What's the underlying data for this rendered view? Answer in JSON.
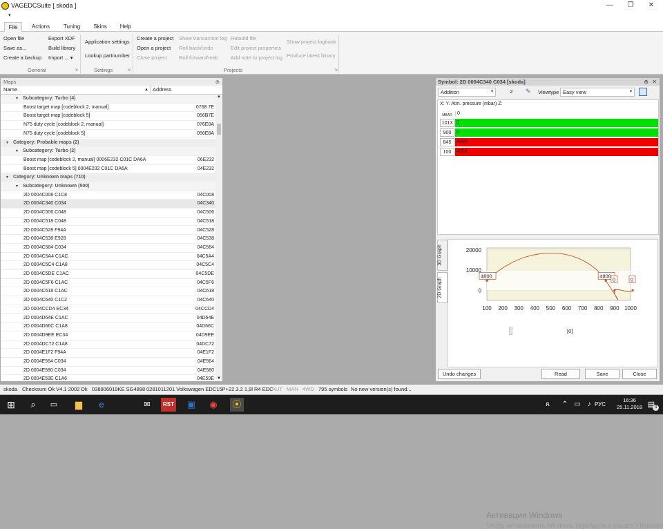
{
  "window": {
    "title": "VAGEDCSuite [ skoda ]"
  },
  "ribbon": {
    "tabs": [
      "File",
      "Actions",
      "Tuning",
      "Skins",
      "Help"
    ],
    "general": {
      "items": [
        "Open file",
        "Save as...",
        "Create a backup",
        "Export XDF",
        "Build library",
        "Import ..."
      ],
      "label": "General"
    },
    "settings": {
      "items": [
        "Application settings",
        "Lookup partnumber"
      ],
      "label": "Settings"
    },
    "projects": {
      "items": [
        "Create a project",
        "Open a project",
        "Close project",
        "Show transaction log",
        "Roll back/undo",
        "Roll forward/redo",
        "Rebuild file",
        "Edit project properties",
        "Add note to project log",
        "Show project logbook",
        "Produce latest binary"
      ],
      "label": "Projects"
    }
  },
  "maps": {
    "panel_title": "Maps",
    "pin": "⊕",
    "col_name": "Name",
    "col_address": "Address",
    "rows": [
      {
        "t": "sub",
        "n": "Subcategory: Turbo (4)"
      },
      {
        "t": "item",
        "n": "Boost target map [codeblock 2, manual]",
        "a": "0768 7E"
      },
      {
        "t": "item",
        "n": "Boost target map [codeblock 5]",
        "a": "056B7E"
      },
      {
        "t": "item",
        "n": "N75 duty cycle [codeblock 2, manual]",
        "a": "076E8A"
      },
      {
        "t": "item",
        "n": "N75 duty cycle [codeblock 5]",
        "a": "056E8A"
      },
      {
        "t": "cat",
        "n": "Category: Probable maps (2)"
      },
      {
        "t": "sub",
        "n": "Subcategory: Turbo (2)"
      },
      {
        "t": "item",
        "n": "Boost map [codeblock 2, manual] 0006E232 C01C DA6A",
        "a": "06E232"
      },
      {
        "t": "item",
        "n": "Boost map [codeblock 5] 0004E232 C01C DA6A",
        "a": "04E232"
      },
      {
        "t": "cat",
        "n": "Category: Unknown maps (710)"
      },
      {
        "t": "sub",
        "n": "Subcategory: Unknown (500)"
      },
      {
        "t": "item",
        "n": "2D 0004C008 C1C8",
        "a": "04C008"
      },
      {
        "t": "item",
        "n": "2D 0004C340 C034",
        "a": "04C340",
        "sel": true
      },
      {
        "t": "item",
        "n": "2D 0004C506 C048",
        "a": "04C506"
      },
      {
        "t": "item",
        "n": "2D 0004C518 C048",
        "a": "04C518"
      },
      {
        "t": "item",
        "n": "2D 0004C528 F94A",
        "a": "04C528"
      },
      {
        "t": "item",
        "n": "2D 0004C538 E928",
        "a": "04C538"
      },
      {
        "t": "item",
        "n": "2D 0004C584 C034",
        "a": "04C584"
      },
      {
        "t": "item",
        "n": "2D 0004C5A4 C1AC",
        "a": "04C5A4"
      },
      {
        "t": "item",
        "n": "2D 0004C5C4 C1A8",
        "a": "04C5C4"
      },
      {
        "t": "item",
        "n": "2D 0004C5DE C1AC",
        "a": "04C5DE"
      },
      {
        "t": "item",
        "n": "2D 0004C5F6 C1AC",
        "a": "04C5F6"
      },
      {
        "t": "item",
        "n": "2D 0004C618 C1AC",
        "a": "04C618"
      },
      {
        "t": "item",
        "n": "2D 0004C640 C1C2",
        "a": "04C640"
      },
      {
        "t": "item",
        "n": "2D 0004CCD4 EC34",
        "a": "04CCD4"
      },
      {
        "t": "item",
        "n": "2D 0004D64E C1AC",
        "a": "04D64E"
      },
      {
        "t": "item",
        "n": "2D 0004D66C C1A8",
        "a": "04D66C"
      },
      {
        "t": "item",
        "n": "2D 0004D9EE EC34",
        "a": "04D9EE"
      },
      {
        "t": "item",
        "n": "2D 0004DC72 C1A8",
        "a": "04DC72"
      },
      {
        "t": "item",
        "n": "2D 0004E1F2 F94A",
        "a": "04E1F2"
      },
      {
        "t": "item",
        "n": "2D 0004E564 C034",
        "a": "04E564"
      },
      {
        "t": "item",
        "n": "2D 0004E580 C034",
        "a": "04E580"
      },
      {
        "t": "item",
        "n": "2D 0004E59E C1A6",
        "a": "04E59E"
      }
    ]
  },
  "symbol": {
    "title": "Symbol: 2D 0004C340 C034 [skoda]",
    "mode": "Addition",
    "amount": "2",
    "viewtype_label": "Viewtype",
    "viewtype": "Easy view",
    "axis_header": "X:  Y: Atm. pressure (mbar) Z:",
    "unit": "MBAR",
    "header_value": "0",
    "rows": [
      {
        "label": "1013",
        "value": "0",
        "color": "#00e000"
      },
      {
        "label": "900",
        "value": "0",
        "color": "#00e000"
      },
      {
        "label": "845",
        "value": "4800",
        "color": "#ee0000"
      },
      {
        "label": "100",
        "value": "4800",
        "color": "#ee0000"
      }
    ],
    "tabs": [
      "3D Graph",
      "2D Graph"
    ],
    "slider_value": "[0]",
    "buttons": {
      "undo": "Undo changes",
      "read": "Read",
      "save": "Save",
      "close": "Close"
    },
    "activation_title": "Активация Windows",
    "activation_text": "Чтобы активировать Windows, перейдите в раздел \"Параметры\"."
  },
  "chart_data": {
    "type": "line",
    "x": [
      100,
      845,
      900,
      1013
    ],
    "y": [
      4800,
      4800,
      0,
      0
    ],
    "labels": [
      "4800",
      "4800",
      "0",
      "0"
    ],
    "xticks": [
      100,
      200,
      300,
      400,
      500,
      600,
      700,
      800,
      900,
      1000
    ],
    "yticks": [
      0,
      10000,
      20000
    ],
    "xlim": [
      100,
      1000
    ],
    "ylim": [
      -5000,
      21000
    ]
  },
  "status": {
    "items": [
      "skoda",
      "Checksum Ok V4.1 2002",
      "Ok",
      "038906019KE SG4898",
      "0281011201 Volkswagen EDC15P+22.3.2 1,9l R4 EDC",
      "AUT",
      "MAN",
      "4WD",
      "795 symbols",
      "No new version(s) found..."
    ]
  },
  "taskbar": {
    "time": "16:36",
    "date": "25.11.2018",
    "lang": "РУС",
    "notif": "4"
  }
}
